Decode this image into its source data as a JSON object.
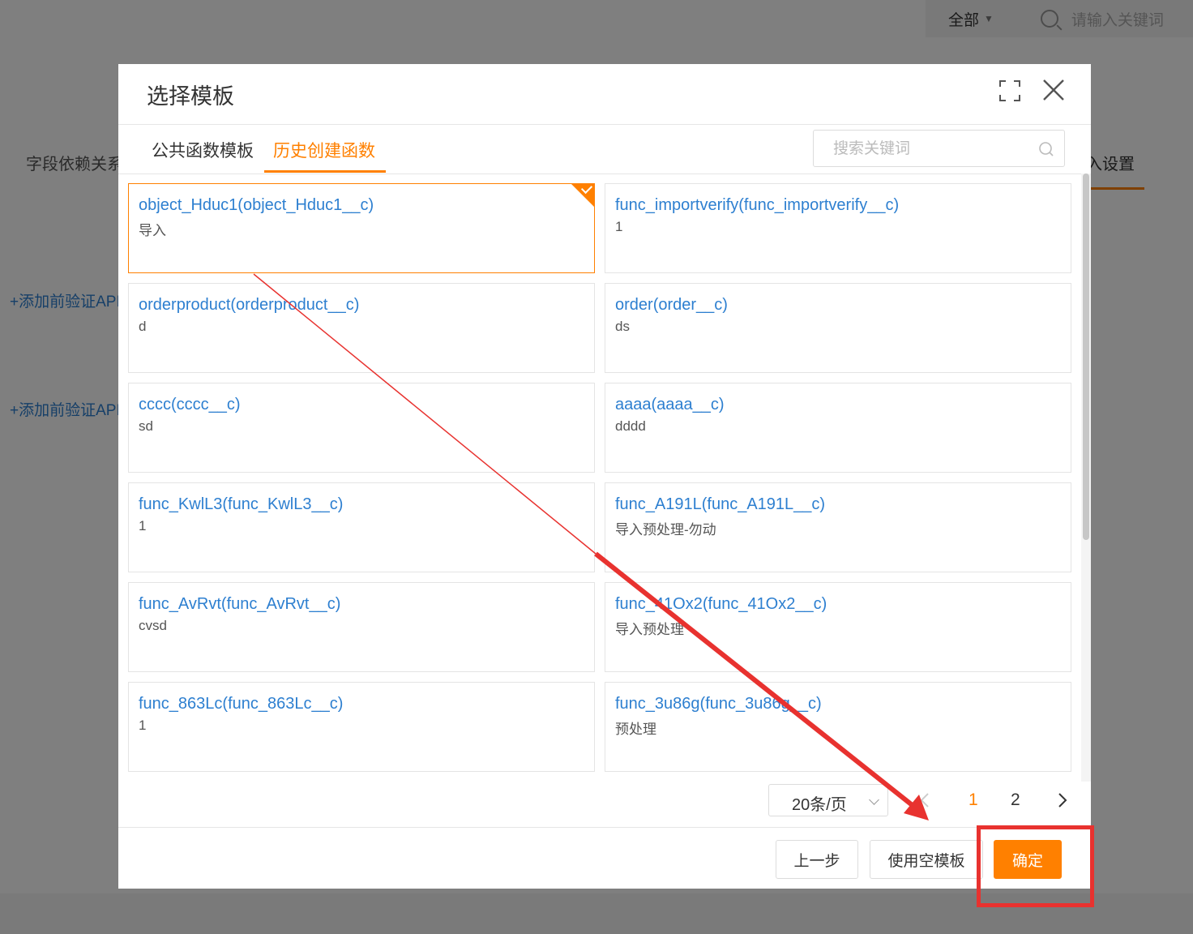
{
  "background": {
    "filter_all": "全部",
    "search_placeholder": "请输入关键词",
    "tab_left": "字段依赖关系",
    "tab_right": "入设置",
    "link_1": "+添加前验证API",
    "link_2": "+添加前验证API"
  },
  "modal": {
    "title": "选择模板",
    "tabs": [
      {
        "label": "公共函数模板",
        "active": false
      },
      {
        "label": "历史创建函数",
        "active": true
      }
    ],
    "search_placeholder": "搜索关键词",
    "cards": [
      {
        "title": "object_Hduc1(object_Hduc1__c)",
        "desc": "导入",
        "selected": true
      },
      {
        "title": "func_importverify(func_importverify__c)",
        "desc": "1",
        "selected": false
      },
      {
        "title": "orderproduct(orderproduct__c)",
        "desc": "d",
        "selected": false
      },
      {
        "title": "order(order__c)",
        "desc": "ds",
        "selected": false
      },
      {
        "title": "cccc(cccc__c)",
        "desc": "sd",
        "selected": false
      },
      {
        "title": "aaaa(aaaa__c)",
        "desc": "dddd",
        "selected": false
      },
      {
        "title": "func_KwlL3(func_KwlL3__c)",
        "desc": "1",
        "selected": false
      },
      {
        "title": "func_A191L(func_A191L__c)",
        "desc": "导入预处理-勿动",
        "selected": false
      },
      {
        "title": "func_AvRvt(func_AvRvt__c)",
        "desc": "cvsd",
        "selected": false
      },
      {
        "title": "func_41Ox2(func_41Ox2__c)",
        "desc": "导入预处理",
        "selected": false
      },
      {
        "title": "func_863Lc(func_863Lc__c)",
        "desc": "1",
        "selected": false
      },
      {
        "title": "func_3u86g(func_3u86g__c)",
        "desc": "预处理",
        "selected": false
      }
    ],
    "pagination": {
      "page_size": "20条/页",
      "pages": [
        "1",
        "2"
      ],
      "current_page": "1"
    },
    "footer": {
      "prev_label": "上一步",
      "empty_label": "使用空模板",
      "ok_label": "确定"
    }
  },
  "colors": {
    "accent": "#ff8000",
    "link": "#2d7fd0",
    "annotation": "#e8322f"
  }
}
